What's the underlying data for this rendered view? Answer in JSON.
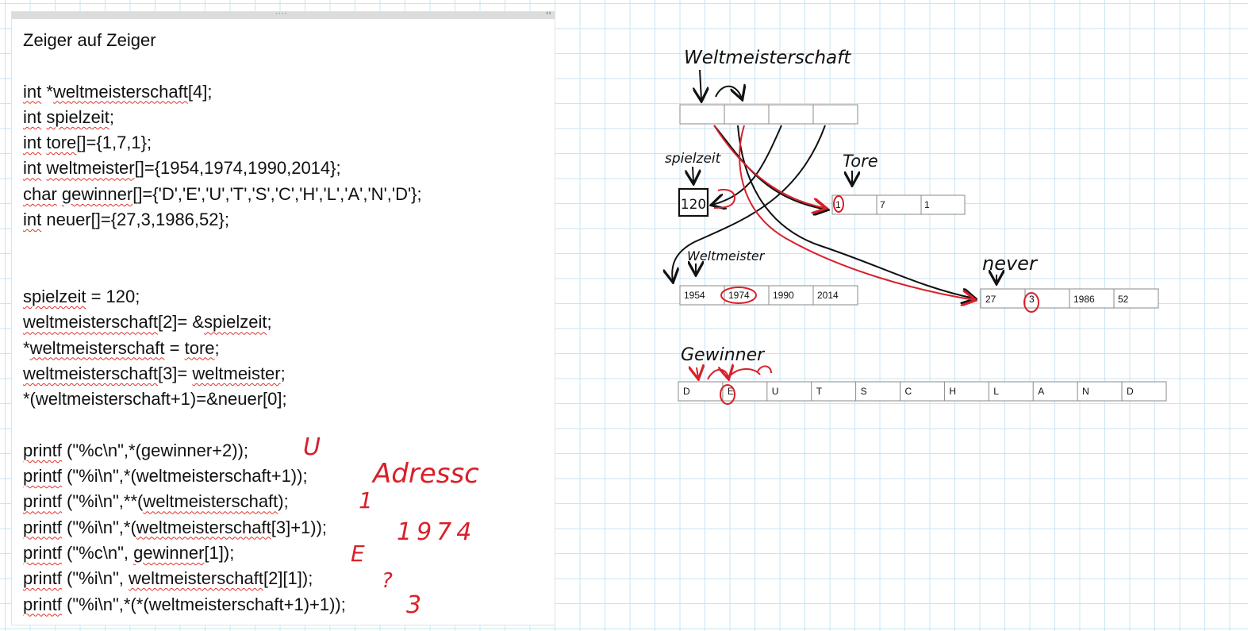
{
  "note": {
    "title": "Zeiger auf Zeiger",
    "declarations": [
      [
        {
          "t": "int",
          "sp": true
        },
        {
          "t": " *"
        },
        {
          "t": "weltmeisterschaft",
          "sp": true
        },
        {
          "t": "[4];"
        }
      ],
      [
        {
          "t": "int",
          "sp": true
        },
        {
          "t": " "
        },
        {
          "t": "spielzeit",
          "sp": true
        },
        {
          "t": ";"
        }
      ],
      [
        {
          "t": "int",
          "sp": true
        },
        {
          "t": " "
        },
        {
          "t": "tore",
          "sp": true
        },
        {
          "t": "[]={1,7,1};"
        }
      ],
      [
        {
          "t": "int",
          "sp": true
        },
        {
          "t": " "
        },
        {
          "t": "weltmeister",
          "sp": true
        },
        {
          "t": "[]={1954,1974,1990,2014};"
        }
      ],
      [
        {
          "t": "char",
          "sp": true
        },
        {
          "t": " "
        },
        {
          "t": "gewinner",
          "sp": true
        },
        {
          "t": "[]={'D','E','U','T','S','C','H','L','A','N','D'};"
        }
      ],
      [
        {
          "t": "int",
          "sp": true
        },
        {
          "t": " neuer[]={27,3,1986,52};"
        }
      ]
    ],
    "assignments": [
      [
        {
          "t": "spielzeit",
          "sp": true
        },
        {
          "t": " = 120;"
        }
      ],
      [
        {
          "t": "weltmeisterschaft",
          "sp": true
        },
        {
          "t": "[2]= &"
        },
        {
          "t": "spielzeit",
          "sp": true
        },
        {
          "t": ";"
        }
      ],
      [
        {
          "t": "*"
        },
        {
          "t": "weltmeisterschaft",
          "sp": true
        },
        {
          "t": " = "
        },
        {
          "t": "tore",
          "sp": true
        },
        {
          "t": ";"
        }
      ],
      [
        {
          "t": "weltmeisterschaft",
          "sp": true
        },
        {
          "t": "[3]= "
        },
        {
          "t": "weltmeister",
          "sp": true
        },
        {
          "t": ";"
        }
      ],
      [
        {
          "t": "*(weltmeisterschaft+1)=&neuer[0];"
        }
      ]
    ],
    "prints": [
      [
        {
          "t": "printf",
          "sp": true
        },
        {
          "t": " (\"%c\\n\",*(gewinner+2));"
        }
      ],
      [
        {
          "t": "printf",
          "sp": true
        },
        {
          "t": " (\"%i\\n\",*(weltmeisterschaft+1));"
        }
      ],
      [
        {
          "t": "printf",
          "sp": true
        },
        {
          "t": " (\"%i\\n\",**("
        },
        {
          "t": "weltmeisterschaft",
          "sp": true
        },
        {
          "t": ");"
        }
      ],
      [
        {
          "t": "printf",
          "sp": true
        },
        {
          "t": " (\"%i\\n\",*("
        },
        {
          "t": "weltmeisterschaft",
          "sp": true
        },
        {
          "t": "[3]+1));"
        }
      ],
      [
        {
          "t": "printf",
          "sp": true
        },
        {
          "t": " (\"%c\\n\", "
        },
        {
          "t": "gewinner",
          "sp": true
        },
        {
          "t": "[1]);"
        }
      ],
      [
        {
          "t": "printf",
          "sp": true
        },
        {
          "t": " (\"%i\\n\", "
        },
        {
          "t": "weltmeisterschaft",
          "sp": true
        },
        {
          "t": "[2][1]);"
        }
      ],
      [
        {
          "t": "printf",
          "sp": true
        },
        {
          "t": " (\"%i\\n\",*(*(weltmeisterschaft+1)+1));"
        }
      ]
    ],
    "answers": [
      "U",
      "Adressc",
      "1",
      "1974",
      "E",
      "?",
      "3"
    ]
  },
  "diagram": {
    "labels": {
      "weltmeisterschaft": "Weltmeisterschaft",
      "spielzeit": "spielzeit",
      "tore": "Tore",
      "weltmeister": "Weltmeister",
      "neuer": "never",
      "gewinner": "Gewinner"
    },
    "spielzeit_value": "120",
    "tore": [
      "1",
      "7",
      "1"
    ],
    "weltmeister": [
      "1954",
      "1974",
      "1990",
      "2014"
    ],
    "neuer": [
      "27",
      "3",
      "1986",
      "52"
    ],
    "gewinner": [
      "D",
      "E",
      "U",
      "T",
      "S",
      "C",
      "H",
      "L",
      "A",
      "N",
      "D"
    ]
  },
  "colors": {
    "ink": "#111111",
    "annotation": "#d9202a",
    "grid": "#c9e4f3",
    "misspelling": "#e0322e"
  }
}
